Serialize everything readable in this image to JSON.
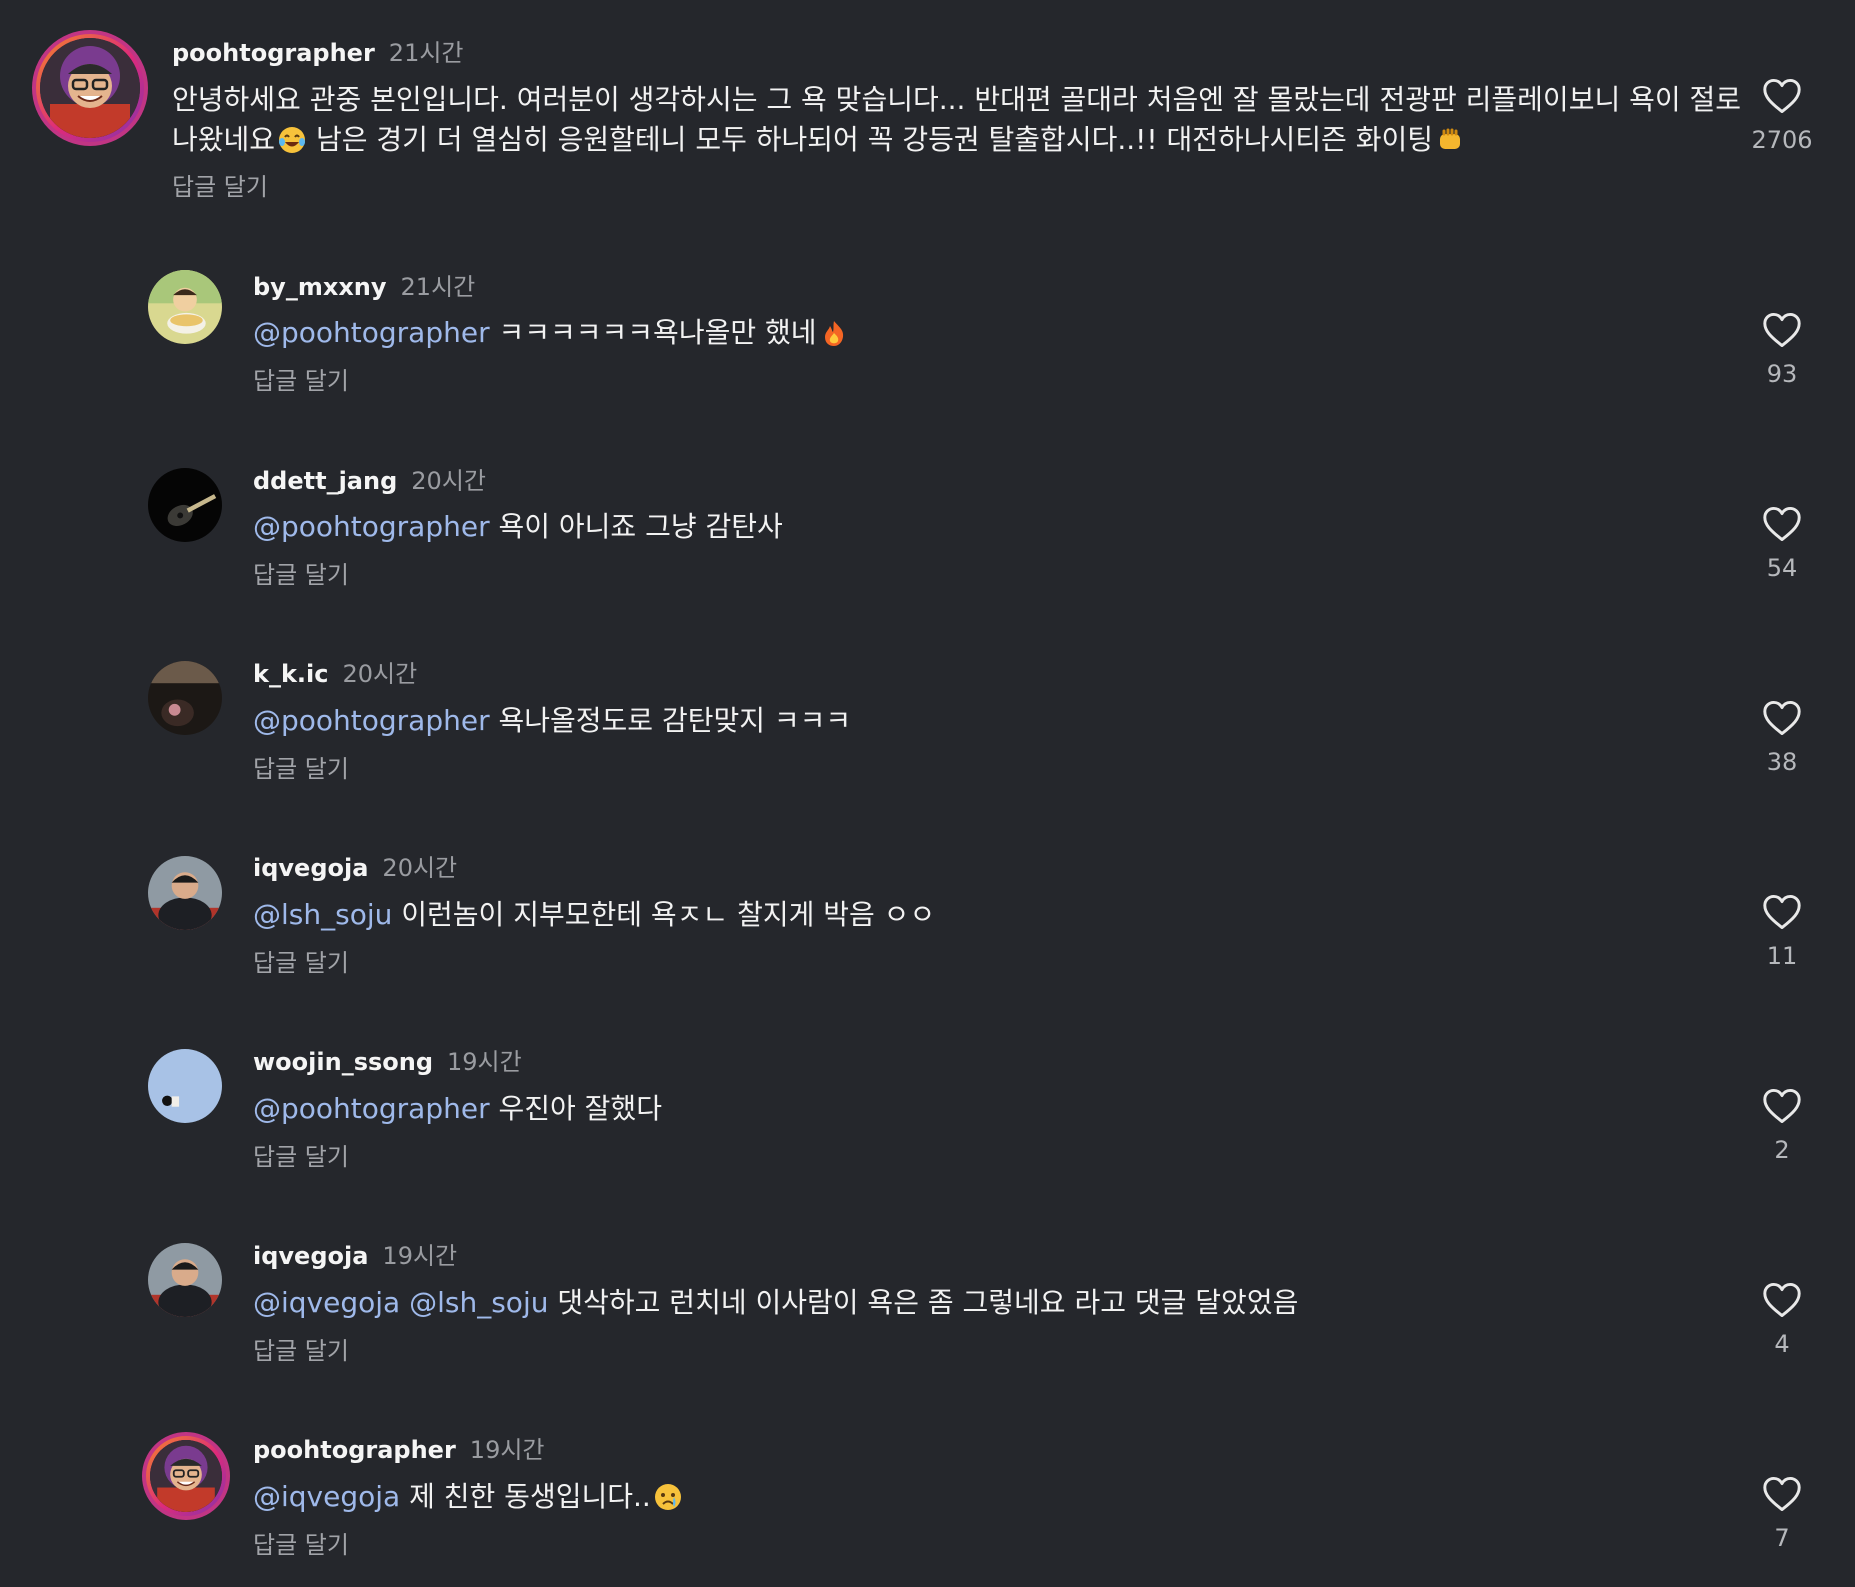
{
  "comments": [
    {
      "username": "poohtographer",
      "time": "21시간",
      "segments": [
        {
          "text": "안녕하세요 관중 본인입니다. 여러분이 생각하시는 그 욕 맞습니다... 반대편 골대라 처음엔 잘 몰랐는데 전광판 리플레이보니 욕이 절로",
          "mention": false
        }
      ],
      "segments_line2": [
        {
          "text": "나왔네요",
          "mention": false
        },
        {
          "emoji": "laughing-tears-emoji"
        },
        {
          "text": " 남은 경기 더 열심히 응원할테니 모두 하나되어 꼭 강등권 탈출합시다..!! 대전하나시티즌 화이팅",
          "mention": false
        },
        {
          "emoji": "fist-emoji"
        }
      ],
      "reply_label": "답글 달기",
      "likes": "2706",
      "avatar": "poohtographer-avatar"
    },
    {
      "username": "by_mxxny",
      "time": "21시간",
      "segments": [
        {
          "text": "@poohtographer",
          "mention": true
        },
        {
          "text": " ㅋㅋㅋㅋㅋㅋ욕나올만 했네",
          "mention": false
        },
        {
          "emoji": "fire-emoji"
        }
      ],
      "reply_label": "답글 달기",
      "likes": "93",
      "avatar": "cartoon-avatar"
    },
    {
      "username": "ddett_jang",
      "time": "20시간",
      "segments": [
        {
          "text": "@poohtographer",
          "mention": true
        },
        {
          "text": " 욕이 아니죠 그냥 감탄사",
          "mention": false
        }
      ],
      "reply_label": "답글 달기",
      "likes": "54",
      "avatar": "guitar-avatar"
    },
    {
      "username": "k_k.ic",
      "time": "20시간",
      "segments": [
        {
          "text": "@poohtographer",
          "mention": true
        },
        {
          "text": " 욕나올정도로 감탄맞지 ㅋㅋㅋ",
          "mention": false
        }
      ],
      "reply_label": "답글 달기",
      "likes": "38",
      "avatar": "dark-photo-avatar"
    },
    {
      "username": "iqvegoja",
      "time": "20시간",
      "segments": [
        {
          "text": "@lsh_soju",
          "mention": true
        },
        {
          "text": " 이런놈이 지부모한테 욕ㅈㄴ 찰지게 박음 ㅇㅇ",
          "mention": false
        }
      ],
      "reply_label": "답글 달기",
      "likes": "11",
      "avatar": "person-avatar"
    },
    {
      "username": "woojin_ssong",
      "time": "19시간",
      "segments": [
        {
          "text": "@poohtographer",
          "mention": true
        },
        {
          "text": " 우진아 잘했다",
          "mention": false
        }
      ],
      "reply_label": "답글 달기",
      "likes": "2",
      "avatar": "sky-avatar"
    },
    {
      "username": "iqvegoja",
      "time": "19시간",
      "segments": [
        {
          "text": "@iqvegoja",
          "mention": true
        },
        {
          "text": " ",
          "mention": false
        },
        {
          "text": "@lsh_soju",
          "mention": true
        },
        {
          "text": " 댓삭하고 런치네 이사람이 욕은 좀 그렇네요 라고 댓글 달았었음",
          "mention": false
        }
      ],
      "reply_label": "답글 달기",
      "likes": "4",
      "avatar": "person-avatar"
    },
    {
      "username": "poohtographer",
      "time": "19시간",
      "segments": [
        {
          "text": "@iqvegoja",
          "mention": true
        },
        {
          "text": " 제 친한 동생입니다..",
          "mention": false
        },
        {
          "emoji": "crying-emoji"
        }
      ],
      "reply_label": "답글 달기",
      "likes": "7",
      "avatar": "poohtographer-avatar"
    }
  ],
  "colors": {
    "background": "#25272c",
    "mention": "#9fb9ea",
    "secondary_text": "#9a9ca1",
    "story_ring": "#c13584"
  },
  "icons": {
    "like": "heart-outline-icon"
  }
}
